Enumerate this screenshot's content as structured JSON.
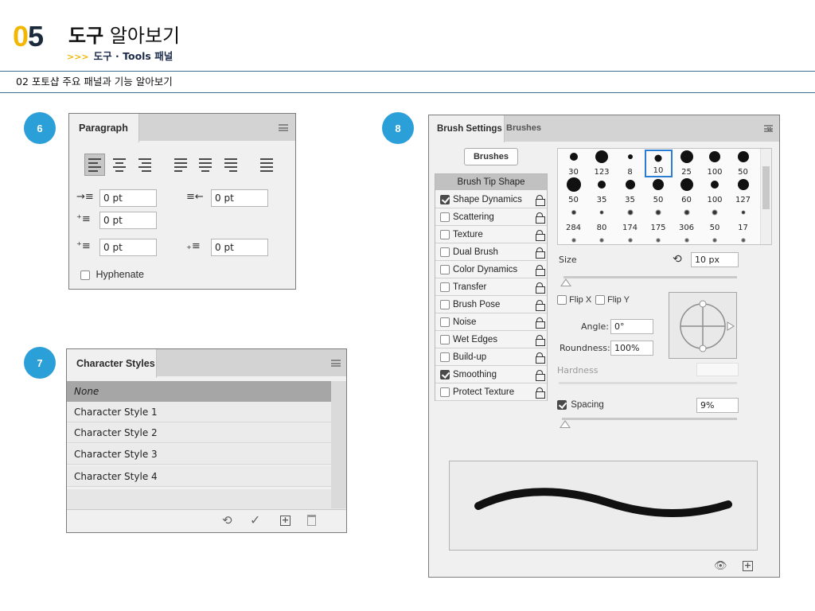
{
  "header": {
    "chapter_num_first": "0",
    "chapter_num_second": "5",
    "title_bold": "도구",
    "title_light": "알아보기",
    "subtitle_arrows": ">>>",
    "subtitle": "도구 · Tools 패널",
    "section": "02 포토샵 주요 패널과 기능 알아보기"
  },
  "badges": {
    "b6": "6",
    "b7": "7",
    "b8": "8"
  },
  "paragraph_panel": {
    "tab": "Paragraph",
    "indent_left": "0 pt",
    "indent_right": "0 pt",
    "indent_first": "0 pt",
    "space_before": "0 pt",
    "space_after": "0 pt",
    "hyphenate": "Hyphenate",
    "hyphenate_checked": false
  },
  "character_styles_panel": {
    "tab": "Character Styles",
    "rows": [
      "None",
      "Character Style 1",
      "Character Style 2",
      "Character Style 3",
      "Character Style 4"
    ]
  },
  "brush_settings_panel": {
    "tab_active": "Brush Settings",
    "tab_inactive": "Brushes",
    "brushes_button": "Brushes",
    "tip_shape": "Brush Tip Shape",
    "options": [
      {
        "label": "Shape Dynamics",
        "checked": true
      },
      {
        "label": "Scattering",
        "checked": false
      },
      {
        "label": "Texture",
        "checked": false
      },
      {
        "label": "Dual Brush",
        "checked": false
      },
      {
        "label": "Color Dynamics",
        "checked": false
      },
      {
        "label": "Transfer",
        "checked": false
      },
      {
        "label": "Brush Pose",
        "checked": false
      },
      {
        "label": "Noise",
        "checked": false
      },
      {
        "label": "Wet Edges",
        "checked": false
      },
      {
        "label": "Build-up",
        "checked": false
      },
      {
        "label": "Smoothing",
        "checked": true
      },
      {
        "label": "Protect Texture",
        "checked": false
      }
    ],
    "brush_sizes": [
      "30",
      "123",
      "8",
      "10",
      "25",
      "100",
      "50",
      "50",
      "35",
      "35",
      "50",
      "60",
      "100",
      "127",
      "284",
      "80",
      "174",
      "175",
      "306",
      "50",
      "17"
    ],
    "selected_brush_index": 3,
    "size_label": "Size",
    "size_value": "10 px",
    "flip_x": "Flip X",
    "flip_y": "Flip Y",
    "angle_label": "Angle:",
    "angle_value": "0°",
    "roundness_label": "Roundness:",
    "roundness_value": "100%",
    "hardness_label": "Hardness",
    "spacing_label": "Spacing",
    "spacing_value": "9%",
    "spacing_checked": true
  }
}
